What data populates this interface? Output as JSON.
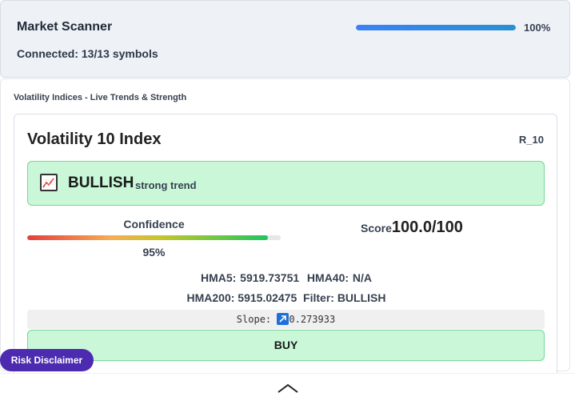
{
  "header": {
    "title": "Market Scanner",
    "connection_status": "Connected: 13/13 symbols",
    "progress_label": "100%",
    "progress_value": 1.0,
    "progress_color": "#3b82f6"
  },
  "section": {
    "title": "Volatility Indices - Live Trends & Strength"
  },
  "card": {
    "title": "Volatility 10 Index",
    "symbol": "R_10",
    "trend": {
      "icon": "chart-increasing-icon",
      "label": "BULLISH",
      "sub_label": "strong trend",
      "color": "#c9f7d8"
    },
    "confidence": {
      "label": "Confidence",
      "value_label": "95%",
      "value": 0.95
    },
    "score": {
      "label": "Score",
      "value": "100.0/100"
    },
    "metrics_line1": "HMA5: 5919.73751  HMA40: N/A",
    "metrics_line2": "HMA200: 5915.02475  Filter: BULLISH",
    "slope": {
      "label": "Slope:",
      "icon": "arrow-up-right-icon",
      "value": "0.273933"
    },
    "action_label": "BUY"
  },
  "disclaimer_label": "Risk Disclaimer",
  "footer": {
    "toggle_icon": "chevron-up-icon"
  }
}
